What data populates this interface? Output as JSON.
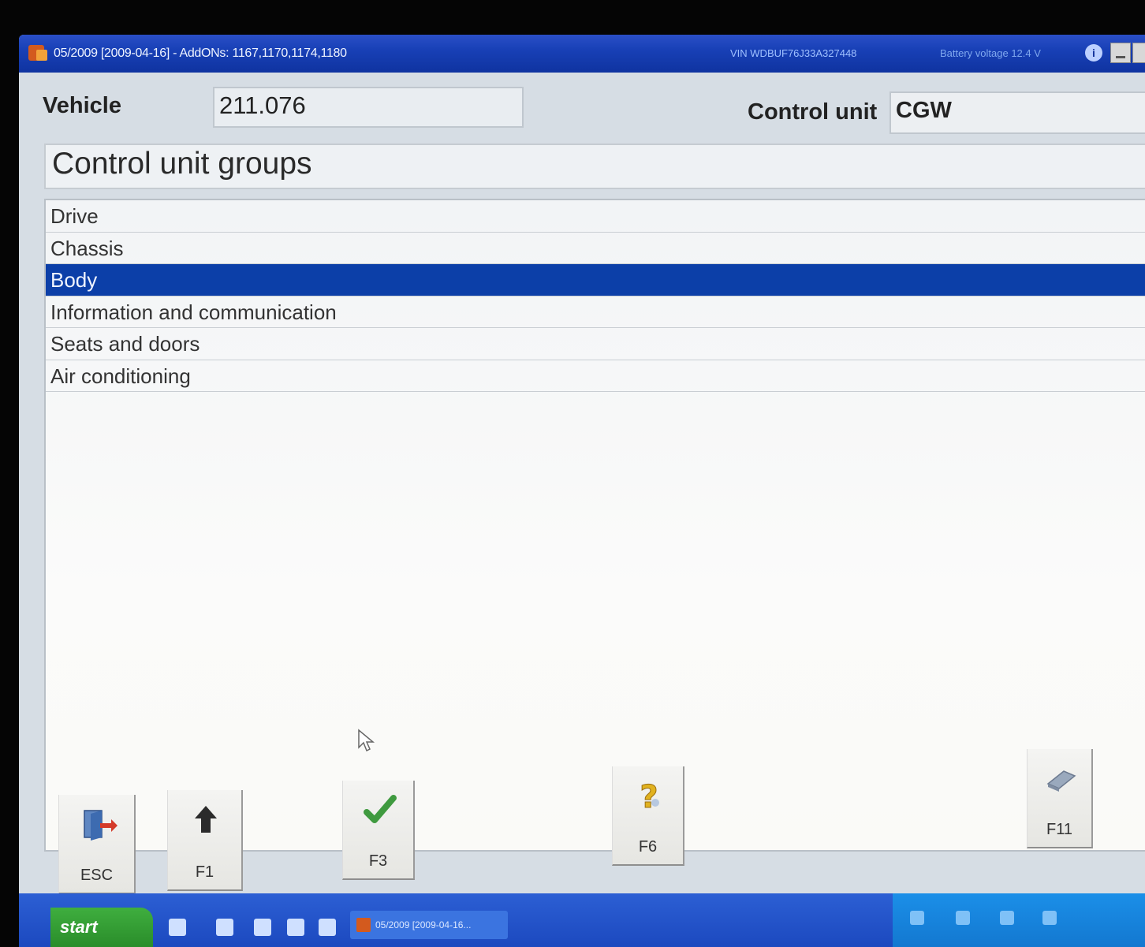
{
  "window": {
    "title": "05/2009 [2009-04-16] - AddONs: 1167,1170,1174,1180",
    "vin": "VIN  WDBUF76J33A327448",
    "battery": "Battery voltage  12.4 V"
  },
  "vehicle": {
    "label": "Vehicle",
    "value": "211.076"
  },
  "control_unit": {
    "label": "Control unit",
    "value": "CGW"
  },
  "section": {
    "title": "Control unit groups"
  },
  "groups": [
    {
      "label": "Drive"
    },
    {
      "label": "Chassis"
    },
    {
      "label": "Body",
      "selected": true
    },
    {
      "label": "Information and communication"
    },
    {
      "label": "Seats and doors"
    },
    {
      "label": "Air conditioning"
    }
  ],
  "toolbar": {
    "esc": "ESC",
    "f1": "F1",
    "f3": "F3",
    "f6": "F6",
    "f11": "F11"
  },
  "taskbar": {
    "start": "start",
    "task_item": "05/2009 [2009-04-16..."
  },
  "colors": {
    "titlebar": "#1840b6",
    "selection": "#0c3fa8",
    "taskbar": "#1c49bf",
    "start": "#2a8d2a"
  }
}
